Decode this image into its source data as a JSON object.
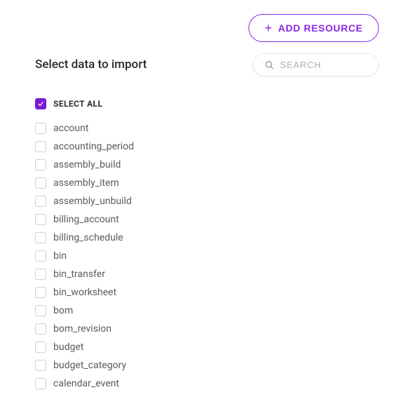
{
  "header": {
    "add_resource_label": "ADD RESOURCE"
  },
  "search": {
    "placeholder": "SEARCH",
    "value": ""
  },
  "title": "Select data to import",
  "select_all": {
    "label": "SELECT ALL",
    "checked": true
  },
  "items": [
    {
      "label": "account",
      "checked": false
    },
    {
      "label": "accounting_period",
      "checked": false
    },
    {
      "label": "assembly_build",
      "checked": false
    },
    {
      "label": "assembly_item",
      "checked": false
    },
    {
      "label": "assembly_unbuild",
      "checked": false
    },
    {
      "label": "billing_account",
      "checked": false
    },
    {
      "label": "billing_schedule",
      "checked": false
    },
    {
      "label": "bin",
      "checked": false
    },
    {
      "label": "bin_transfer",
      "checked": false
    },
    {
      "label": "bin_worksheet",
      "checked": false
    },
    {
      "label": "bom",
      "checked": false
    },
    {
      "label": "bom_revision",
      "checked": false
    },
    {
      "label": "budget",
      "checked": false
    },
    {
      "label": "budget_category",
      "checked": false
    },
    {
      "label": "calendar_event",
      "checked": false
    }
  ]
}
